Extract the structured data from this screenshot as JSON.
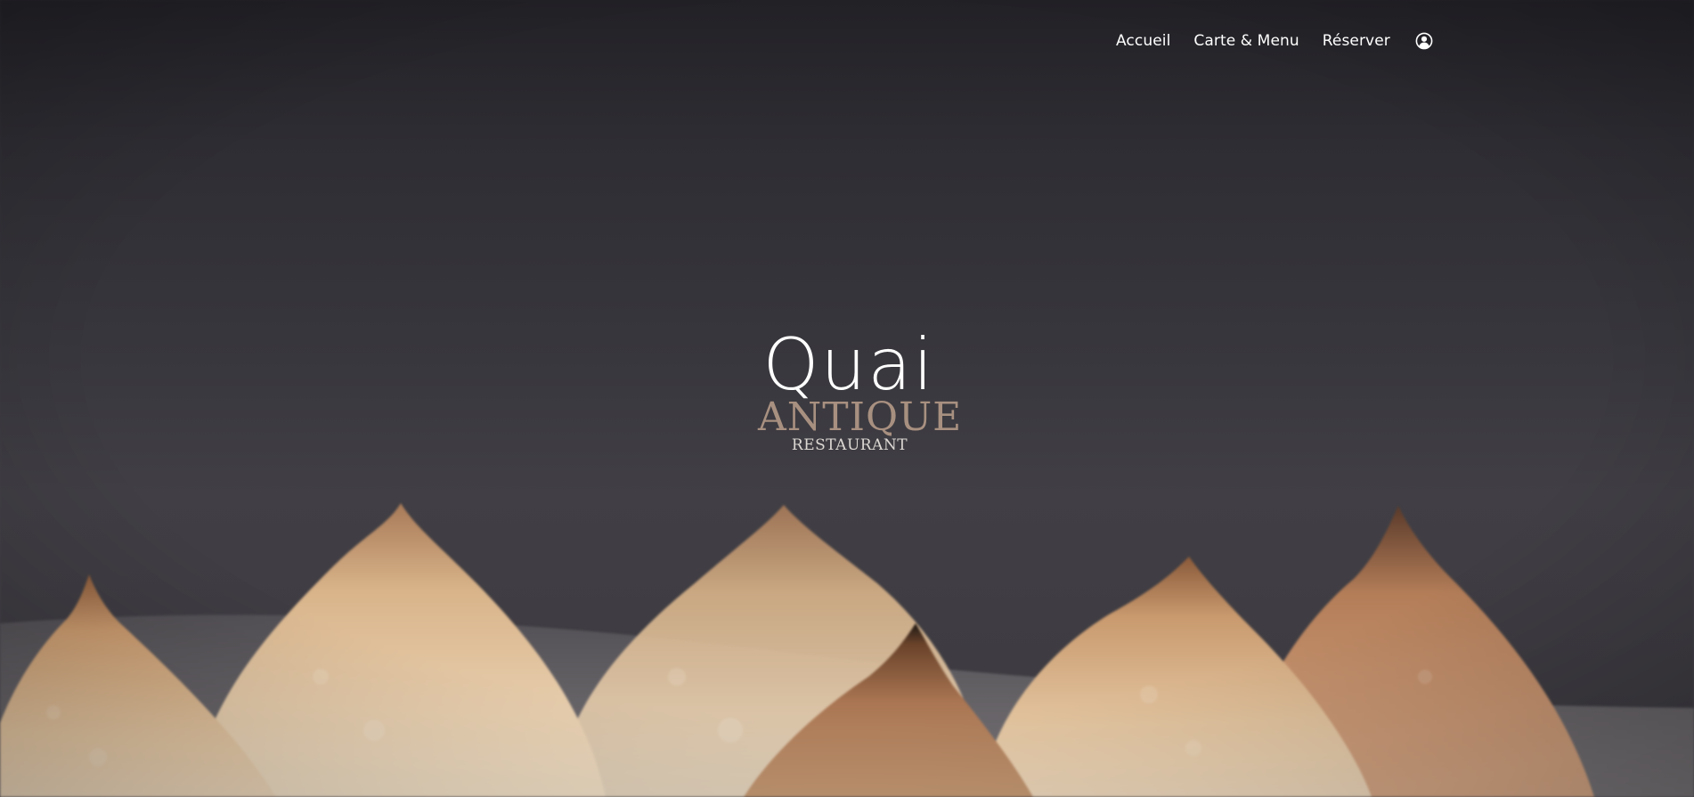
{
  "nav": {
    "items": [
      {
        "label": "Accueil"
      },
      {
        "label": "Carte & Menu"
      },
      {
        "label": "Réserver"
      }
    ],
    "account_icon": "user-circle-icon"
  },
  "logo": {
    "line1": "Quai",
    "line2": "ANTIQUE",
    "line3": "RESTAURANT"
  },
  "hero": {
    "image": "meringue-desserts-photo"
  },
  "colors": {
    "background": "#2b2a2f",
    "nav_text": "#ffffff",
    "logo_accent": "#a89080",
    "logo_secondary": "#ddd8d4"
  }
}
